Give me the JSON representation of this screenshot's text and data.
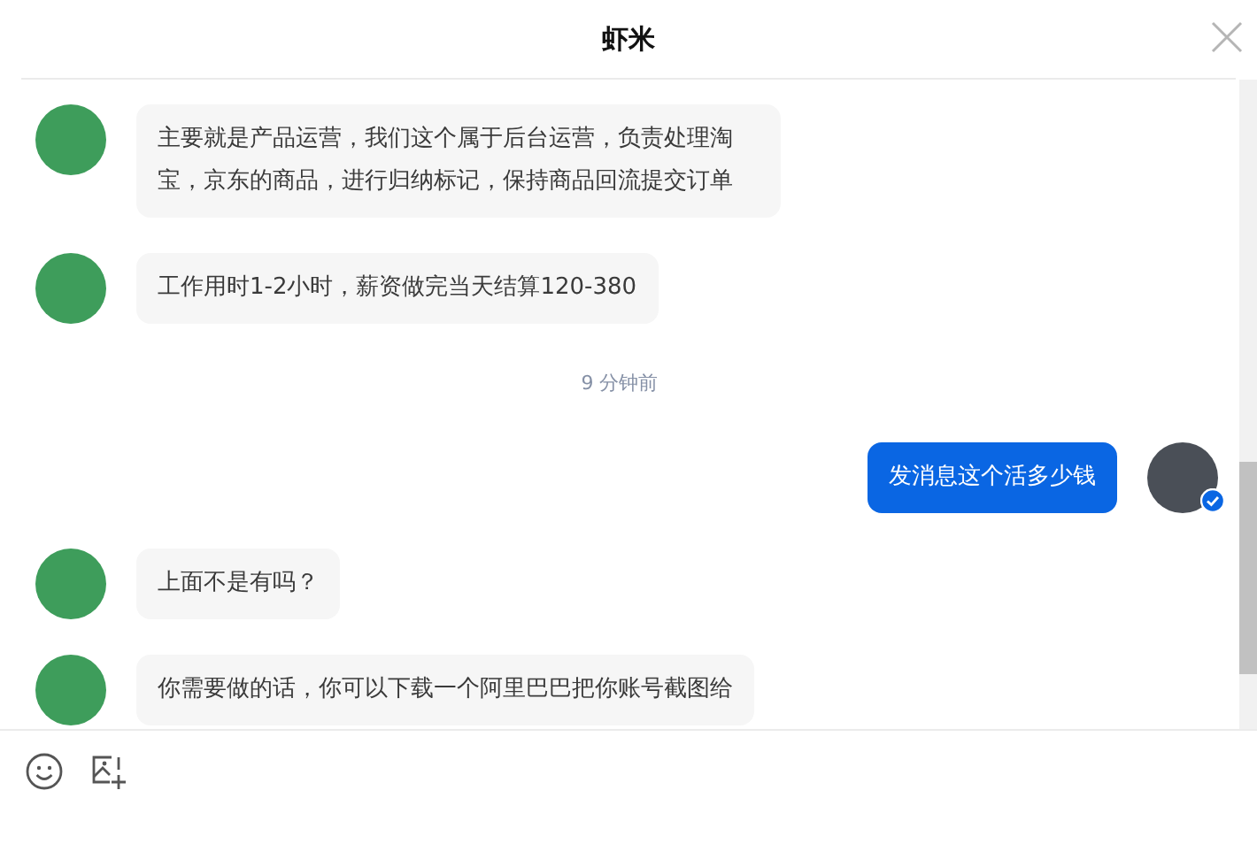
{
  "window": {
    "title": "虾米"
  },
  "messages": [
    {
      "kind": "received",
      "text": "主要就是产品运营，我们这个属于后台运营，负责处理淘宝，京东的商品，进行归纳标记，保持商品回流提交订单"
    },
    {
      "kind": "received",
      "text": "工作用时1-2小时，薪资做完当天结算120-380"
    },
    {
      "kind": "time",
      "text": "9 分钟前"
    },
    {
      "kind": "sent",
      "text": "发消息这个活多少钱"
    },
    {
      "kind": "received",
      "text": "上面不是有吗？"
    },
    {
      "kind": "received",
      "text": "你需要做的话，你可以下载一个阿里巴巴把你账号截图给"
    }
  ]
}
